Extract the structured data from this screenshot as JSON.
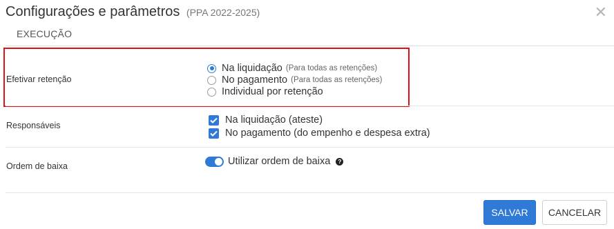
{
  "dialog": {
    "title": "Configurações e parâmetros",
    "subtitle": "(PPA 2022-2025)",
    "close_symbol": "✕",
    "tab": "EXECUÇÃO"
  },
  "retencao": {
    "label": "Efetivar retenção",
    "options": [
      {
        "label": "Na liquidação",
        "hint": "(Para todas as retenções)",
        "selected": true
      },
      {
        "label": "No pagamento",
        "hint": "(Para todas as retenções)",
        "selected": false
      },
      {
        "label": "Individual por retenção",
        "hint": "",
        "selected": false
      }
    ]
  },
  "responsaveis": {
    "label": "Responsáveis",
    "checkboxes": [
      {
        "label": "Na liquidação (ateste)",
        "checked": true
      },
      {
        "label": "No pagamento (do empenho e despesa extra)",
        "checked": true
      }
    ]
  },
  "ordem": {
    "label": "Ordem de baixa",
    "toggle_label": "Utilizar ordem de baixa",
    "toggle_on": true,
    "help_symbol": "?"
  },
  "footer": {
    "save_label": "SALVAR",
    "cancel_label": "CANCELAR"
  },
  "colors": {
    "accent": "#2f7ad6",
    "highlight_border": "#e10f17"
  }
}
